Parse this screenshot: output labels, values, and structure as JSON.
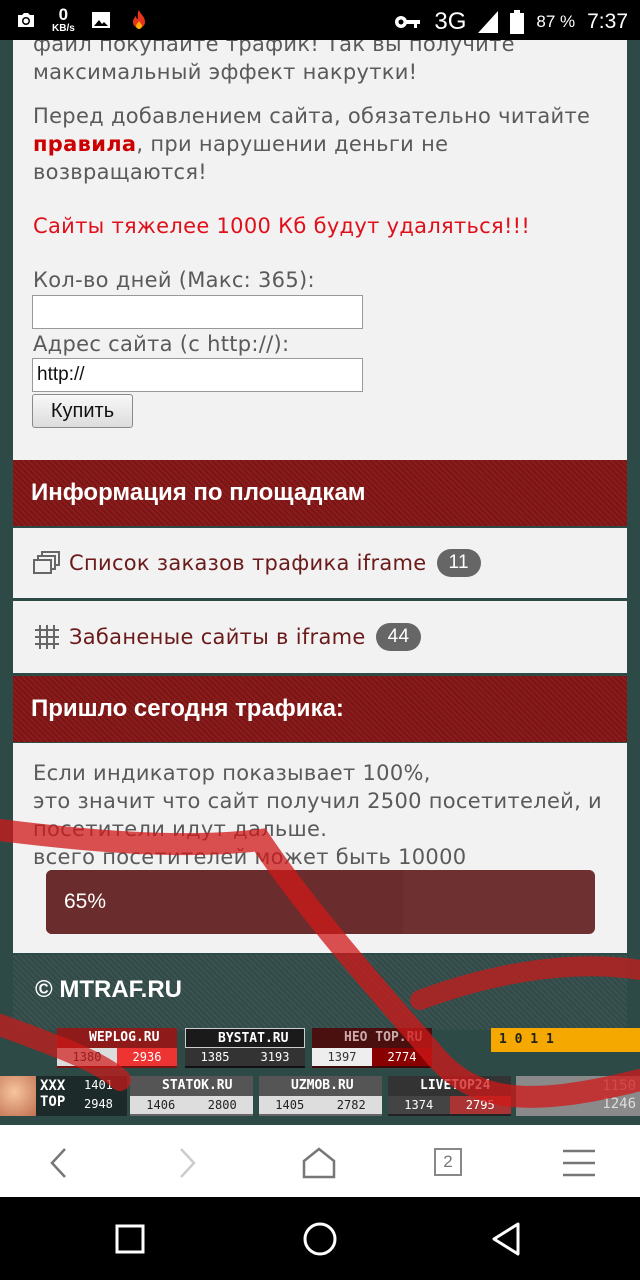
{
  "status_bar": {
    "net_speed_value": "0",
    "net_speed_unit": "KB/s",
    "network": "3G",
    "network_small": "3G",
    "battery_percent": "87 %",
    "time": "7:37"
  },
  "intro": {
    "line1": "файл покупайте трафик! Так вы получите",
    "line2": "максимальный эффект накрутки!",
    "rules_before": "Перед добавлением сайта, обязательно читайте",
    "rules_link": "правила",
    "rules_after": ", при нарушении деньги не",
    "rules_after2": "возвращаются!",
    "warning": "Сайты тяжелее 1000 Кб будут удаляться!!!"
  },
  "form": {
    "days_label": "Кол-во дней (Макс: 365):",
    "days_value": "",
    "url_label": "Адрес сайта (с http://):",
    "url_value": "http://",
    "buy_label": "Купить"
  },
  "info_section": {
    "title": "Информация по площадкам",
    "items": [
      {
        "label": "Список заказов трафика iframe",
        "count": "11",
        "icon": "windows-icon"
      },
      {
        "label": "Забаненые сайты в iframe",
        "count": "44",
        "icon": "grid-icon"
      }
    ]
  },
  "traffic_section": {
    "title": "Пришло сегодня трафика:",
    "desc1": "Если индикатор показывает 100%,",
    "desc2": "это значит что сайт получил 2500 посетителей, и",
    "desc3": "посетители идут дальше.",
    "desc4": "всего посетителей может быть 10000",
    "progress_percent": 65,
    "progress_label": "65%"
  },
  "footer": {
    "copyright": "© MTRAF.RU"
  },
  "counters": {
    "row1": [
      {
        "name": "WEPLOG.RU",
        "a": "1380",
        "b": "2936"
      },
      {
        "name": "BYSTAT.RU",
        "a": "1385",
        "b": "3193"
      },
      {
        "name": "HEO TOP.RU",
        "a": "1397",
        "b": "2774"
      },
      {
        "name": "1 0 1 1",
        "a": "",
        "b": ""
      }
    ],
    "row2": [
      {
        "name": "XXX TOP",
        "a": "1401",
        "b": "2948"
      },
      {
        "name": "STATOK.RU",
        "a": "1406",
        "b": "2800"
      },
      {
        "name": "UZMOB.RU",
        "a": "1405",
        "b": "2782"
      },
      {
        "name": "LIVETOP24",
        "a": "1374",
        "b": "2795"
      },
      {
        "name": "",
        "a": "1150",
        "b": "1246"
      }
    ]
  },
  "browser": {
    "tab_count": "2"
  },
  "colors": {
    "accent_red": "#e0101a",
    "header_red": "#8b1c1c",
    "page_bg": "#2e4a47"
  }
}
